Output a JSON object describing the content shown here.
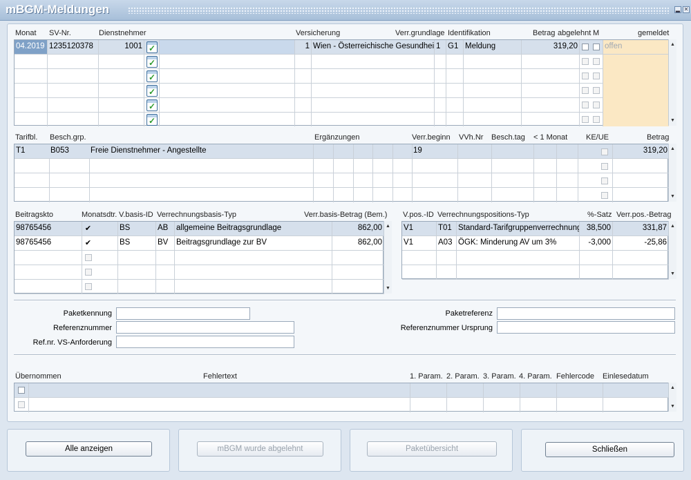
{
  "window": {
    "title": "mBGM-Meldungen",
    "minimize": "▂",
    "close": "✕"
  },
  "grid1": {
    "headers": {
      "monat": "Monat",
      "svnr": "SV-Nr.",
      "dn": "Dienstnehmer",
      "vers": "Versicherung",
      "vg": "Verr.grundlage",
      "ident": "Identifikation",
      "betrag": "Betrag",
      "abgelehnt": "abgelehnt",
      "m": "M",
      "gemeldet": "gemeldet"
    },
    "row1": {
      "monat": "04.2019",
      "svnr": "1235120378",
      "dn": "1001",
      "vers_num": "1",
      "vers_name": "Wien - Österreichische Gesundheit",
      "vg": "1",
      "ident_code": "G1",
      "ident_text": "Meldung",
      "betrag": "319,20",
      "gemeldet": "offen"
    }
  },
  "grid2": {
    "headers": {
      "tarifbl": "Tarifbl.",
      "beschgrp": "Besch.grp.",
      "erg": "Ergänzungen",
      "verrbeginn": "Verr.beginn",
      "vvhnr": "VVh.Nr",
      "beschtag": "Besch.tag",
      "lt1monat": "< 1 Monat",
      "keue": "KE/UE",
      "betrag": "Betrag"
    },
    "row1": {
      "tarifbl": "T1",
      "beschgrp": "B053",
      "desc": "Freie Dienstnehmer - Angestellte",
      "verrbeginn": "19",
      "betrag": "319,20"
    }
  },
  "grid3": {
    "headers": {
      "konto": "Beitragskto",
      "monatsdtr": "Monatsdtr.",
      "vbid": "V.basis-ID",
      "vbtyp": "Verrechnungsbasis-Typ",
      "betrag": "Verr.basis-Betrag (Bem.)"
    },
    "rows": [
      {
        "konto": "98765456",
        "vbid": "BS",
        "code": "AB",
        "typ": "allgemeine Beitragsgrundlage",
        "betrag": "862,00"
      },
      {
        "konto": "98765456",
        "vbid": "BS",
        "code": "BV",
        "typ": "Beitragsgrundlage zur BV",
        "betrag": "862,00"
      }
    ]
  },
  "grid4": {
    "headers": {
      "vposid": "V.pos.-ID",
      "vptyp": "Verrechnungspositions-Typ",
      "satz": "%-Satz",
      "betrag": "Verr.pos.-Betrag"
    },
    "rows": [
      {
        "id": "V1",
        "code": "T01",
        "typ": "Standard-Tarifgruppenverrechnung",
        "satz": "38,500",
        "betrag": "331,87"
      },
      {
        "id": "V1",
        "code": "A03",
        "typ": "ÖGK: Minderung AV um 3%",
        "satz": "-3,000",
        "betrag": "-25,86"
      }
    ]
  },
  "form": {
    "paketkennung": "Paketkennung",
    "referenznummer": "Referenznummer",
    "refnr_vs": "Ref.nr. VS-Anforderung",
    "paketreferenz": "Paketreferenz",
    "refnr_ursprung": "Referenznummer Ursprung"
  },
  "grid5": {
    "headers": {
      "uebernommen": "Übernommen",
      "fehlertext": "Fehlertext",
      "p1": "1. Param.",
      "p2": "2. Param.",
      "p3": "3. Param.",
      "p4": "4. Param.",
      "fehlercode": "Fehlercode",
      "einlesedatum": "Einlesedatum"
    }
  },
  "buttons": {
    "alle": "Alle anzeigen",
    "abgelehnt": "mBGM wurde abgelehnt",
    "paket": "Paketübersicht",
    "schliessen": "Schließen"
  },
  "colors": {
    "selected_row": "#d6e0ec",
    "gemeldet_bg": "#fbe8c4"
  }
}
